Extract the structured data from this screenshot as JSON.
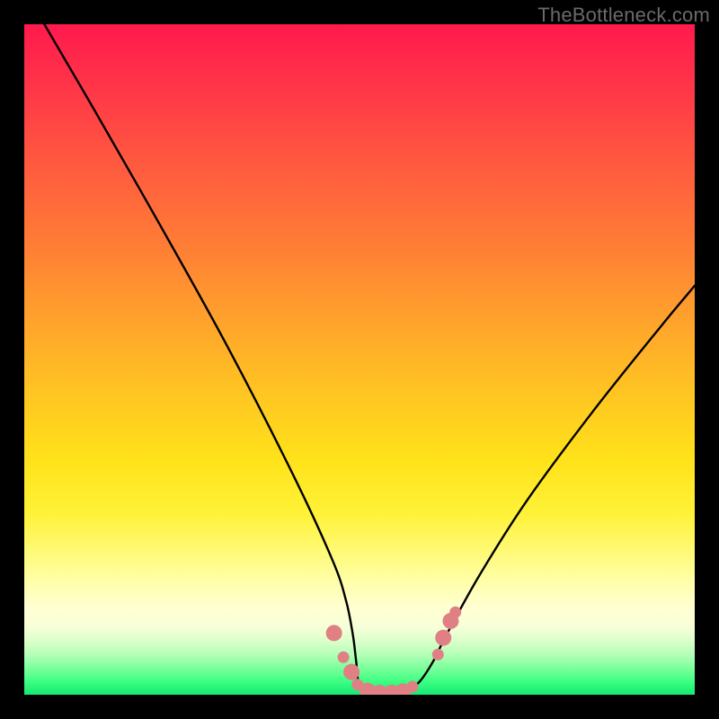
{
  "watermark": "TheBottleneck.com",
  "chart_data": {
    "type": "line",
    "title": "",
    "xlabel": "",
    "ylabel": "",
    "xlim": [
      0,
      100
    ],
    "ylim": [
      0,
      100
    ],
    "series": [
      {
        "name": "curve",
        "x": [
          3,
          10,
          20,
          30,
          40,
          46,
          48,
          49,
          49.5,
          50,
          51.5,
          53,
          55,
          57,
          59,
          61,
          63,
          68,
          75,
          85,
          95,
          100
        ],
        "values": [
          100,
          88,
          70.5,
          52.5,
          33,
          20,
          14,
          9,
          5,
          1,
          0,
          0,
          0,
          0.5,
          2,
          5,
          9,
          18,
          29,
          42.5,
          55,
          61
        ]
      }
    ],
    "markers": {
      "color": "#e08084",
      "radius_large": 9,
      "radius_small": 6.5,
      "points": [
        {
          "x": 46.2,
          "y": 9.2,
          "r": 9
        },
        {
          "x": 47.6,
          "y": 5.6,
          "r": 6.5
        },
        {
          "x": 48.8,
          "y": 3.4,
          "r": 9
        },
        {
          "x": 49.7,
          "y": 1.5,
          "r": 6.5
        },
        {
          "x": 51.2,
          "y": 0.6,
          "r": 9
        },
        {
          "x": 53.0,
          "y": 0.3,
          "r": 9
        },
        {
          "x": 54.8,
          "y": 0.3,
          "r": 9
        },
        {
          "x": 56.5,
          "y": 0.5,
          "r": 9
        },
        {
          "x": 57.9,
          "y": 1.2,
          "r": 6.5
        },
        {
          "x": 61.7,
          "y": 6.0,
          "r": 6.5
        },
        {
          "x": 62.5,
          "y": 8.5,
          "r": 9
        },
        {
          "x": 63.6,
          "y": 11.0,
          "r": 9
        },
        {
          "x": 64.3,
          "y": 12.3,
          "r": 6.5
        }
      ]
    },
    "background_gradient": {
      "top": "#ff1a4d",
      "bottom": "#16e873"
    }
  }
}
